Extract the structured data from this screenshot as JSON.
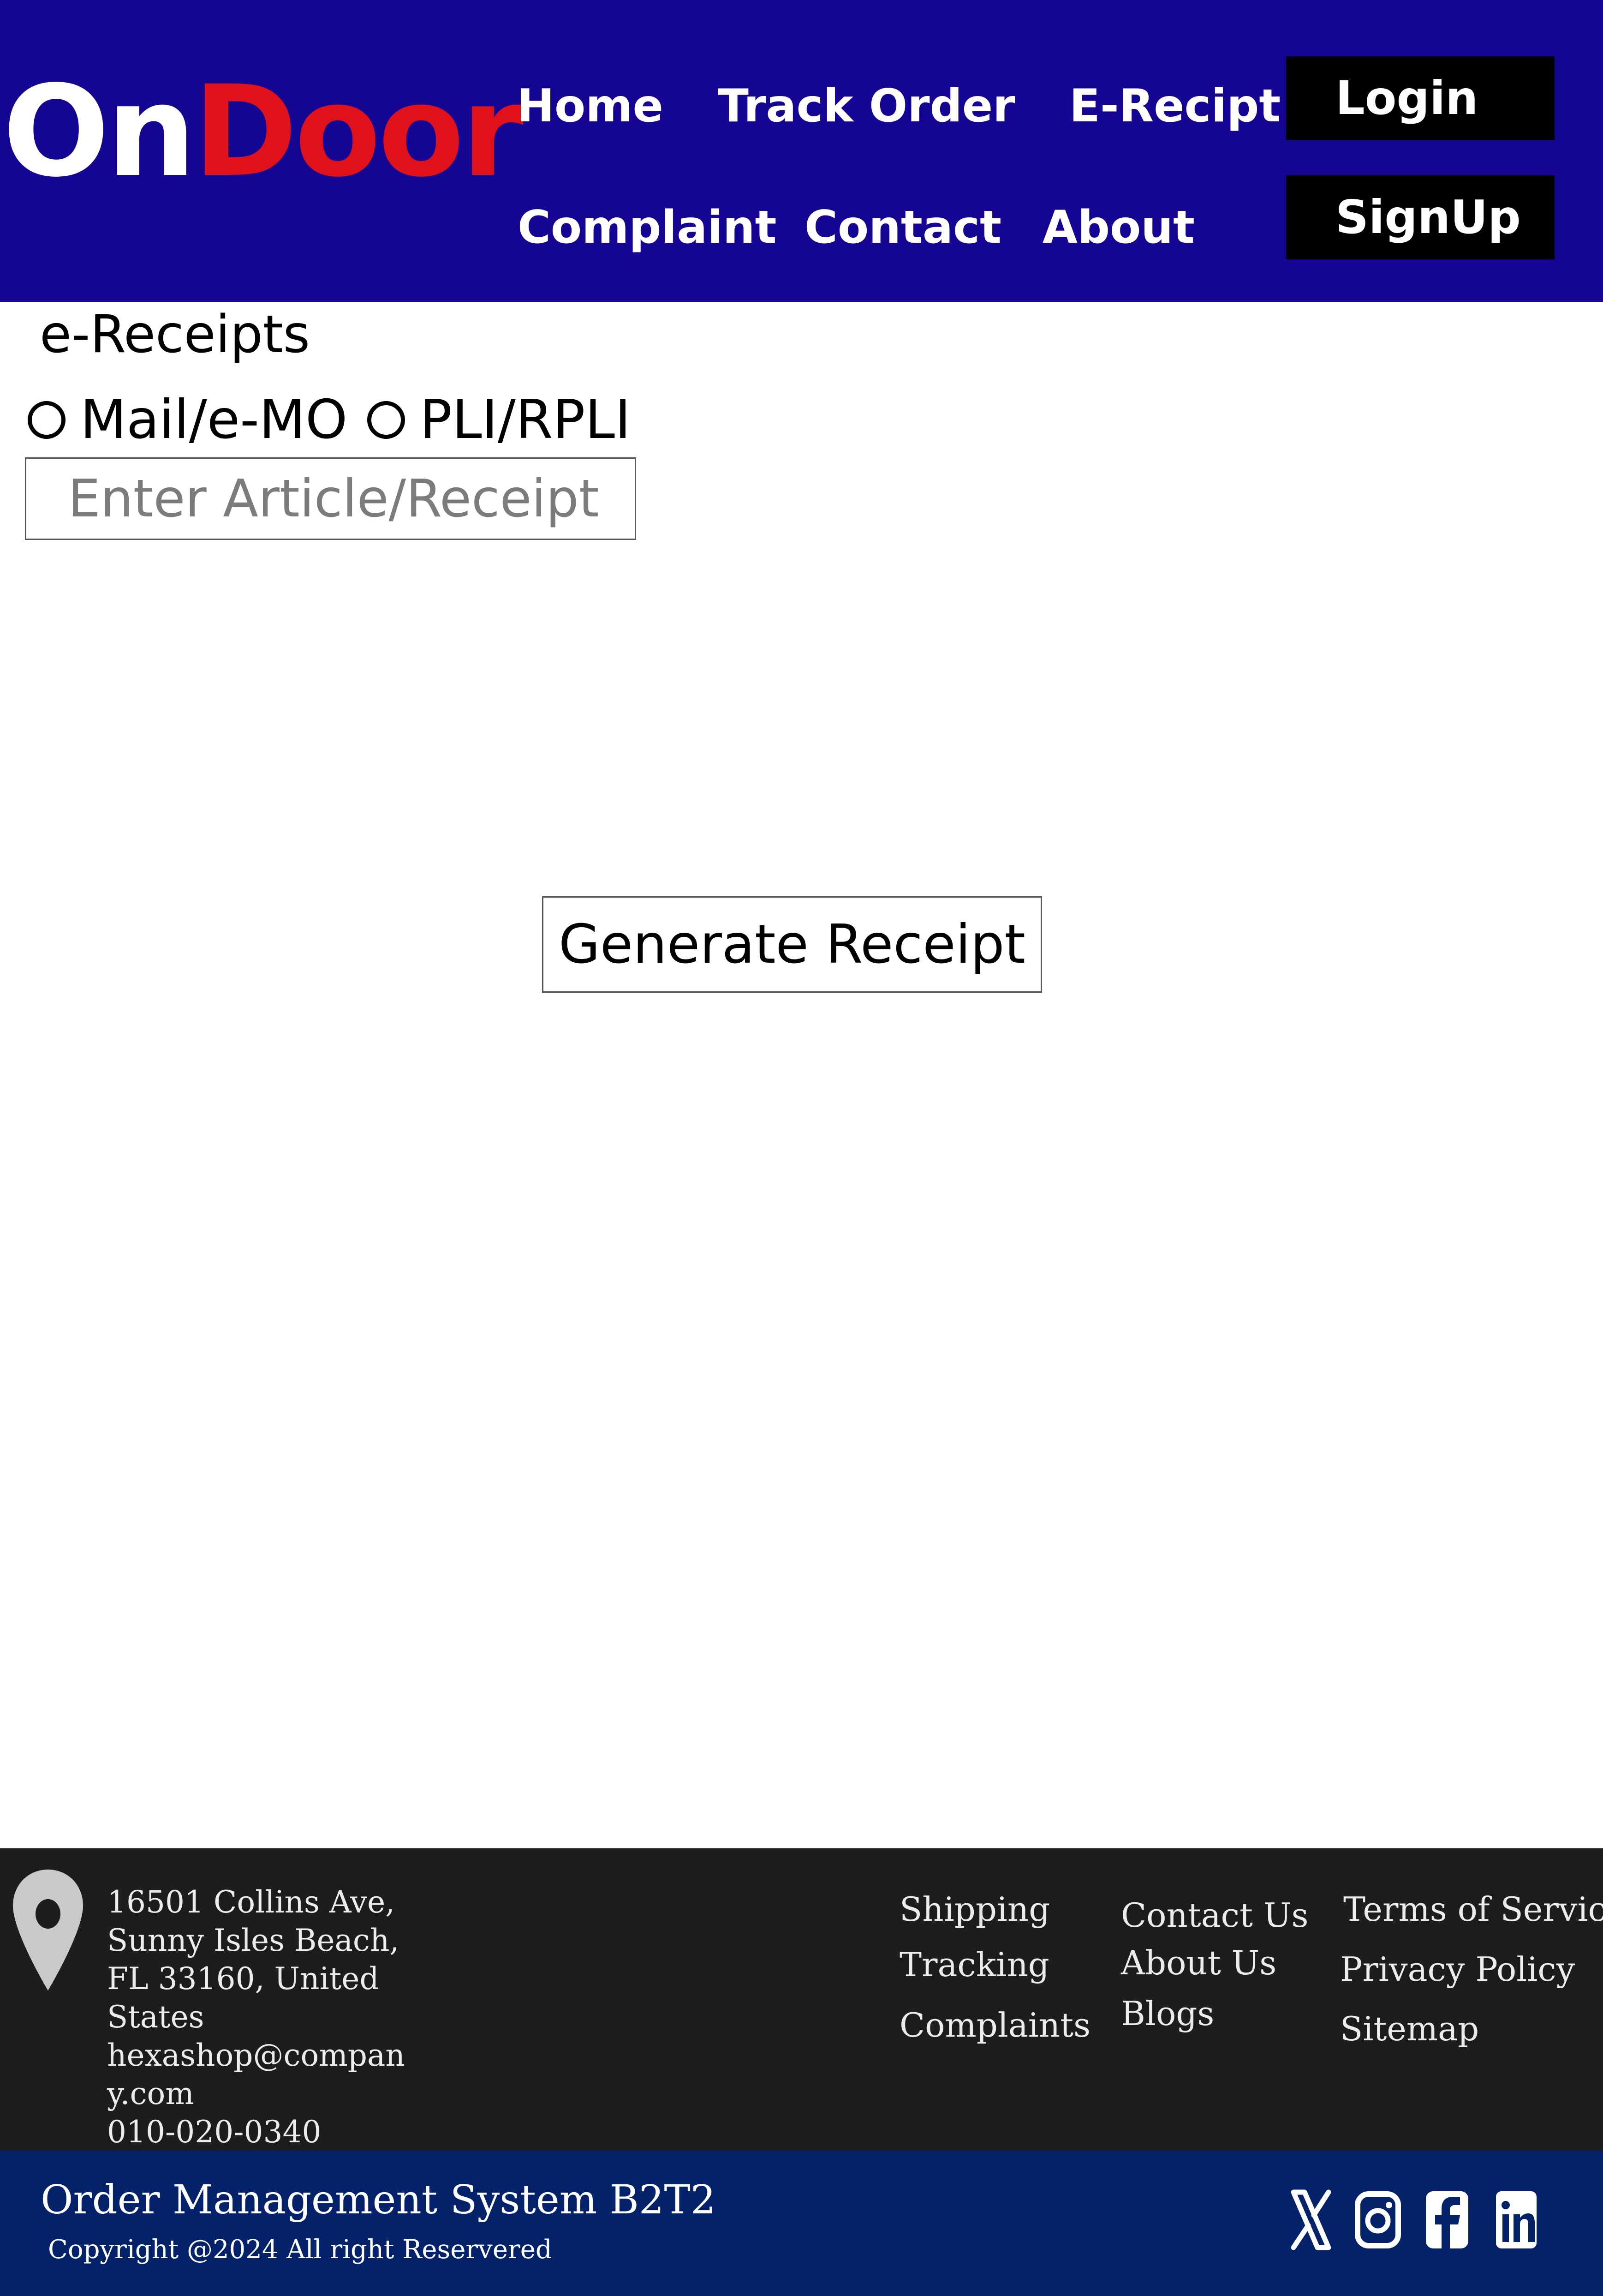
{
  "colors": {
    "header_bg": "#140593",
    "logo_on": "#ffffff",
    "logo_door": "#e0111b",
    "footer_bg": "#1d1d1d",
    "bottom_bar_bg": "#03226a",
    "button_bg": "#000000"
  },
  "header": {
    "logo": {
      "part1": "On",
      "part2": "Door"
    },
    "nav": {
      "home": "Home",
      "track_order": "Track Order",
      "e_recipt": "E-Recipt",
      "complaint": "Complaint",
      "contact": "Contact",
      "about": "About"
    },
    "login_label": "Login",
    "signup_label": "SignUp"
  },
  "main": {
    "title": "e-Receipts",
    "radio_options": [
      "Mail/e-MO",
      "PLI/RPLI"
    ],
    "input_placeholder": "Enter Article/Receipt",
    "input_value": "",
    "generate_label": "Generate Receipt"
  },
  "footer": {
    "address_lines": [
      "16501 Collins Ave,",
      "Sunny Isles Beach,",
      "FL 33160, United",
      "States",
      "hexashop@compan",
      "y.com",
      "010-020-0340"
    ],
    "links_col1": [
      "Shipping",
      "Tracking",
      "Complaints"
    ],
    "links_col2": [
      "Contact Us",
      "About Us",
      "Blogs"
    ],
    "links_col3": [
      "Terms of Service",
      "Privacy  Policy",
      "Sitemap"
    ],
    "system_title": "Order Management System B2T2",
    "copyright": "Copyright @2024 All right Reservered",
    "social_icons": [
      "x-icon",
      "instagram-icon",
      "facebook-icon",
      "linkedin-icon"
    ]
  }
}
